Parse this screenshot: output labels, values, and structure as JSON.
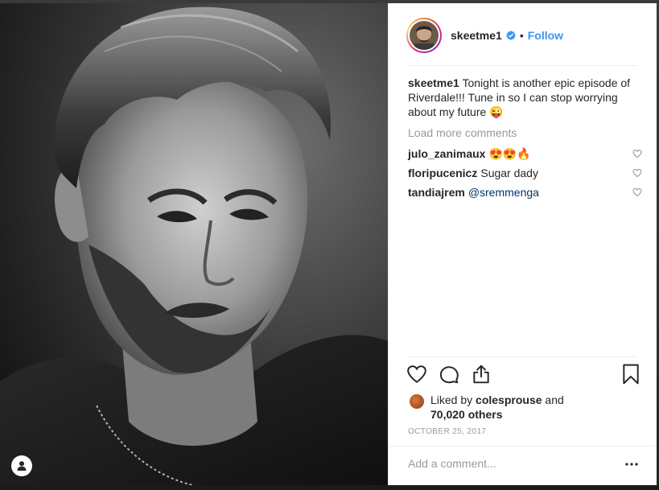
{
  "header": {
    "username": "skeetme1",
    "separator": "•",
    "follow_label": "Follow"
  },
  "caption": {
    "username": "skeetme1",
    "text": "Tonight is another epic episode of Riverdale!!! Tune in so I can stop worrying about my future 😜"
  },
  "load_more_label": "Load more comments",
  "comments": [
    {
      "username": "julo_zanimaux",
      "text": "😍😍🔥"
    },
    {
      "username": "floripucenicz",
      "text": "Sugar dady"
    },
    {
      "username": "tandiajrem",
      "text": "@sremmenga"
    }
  ],
  "likes": {
    "prefix": "Liked by",
    "liker": "colesprouse",
    "connector": "and",
    "others": "70,020 others"
  },
  "date": "OCTOBER 25, 2017",
  "add_comment_placeholder": "Add a comment...",
  "colors": {
    "follow": "#3897f0",
    "verified": "#3897f0",
    "mention": "#003569",
    "muted": "#999999",
    "text": "#262626"
  },
  "icons": [
    "heart-icon",
    "comment-icon",
    "share-icon",
    "bookmark-icon",
    "more-options-icon",
    "verified-badge-icon",
    "profile-icon"
  ]
}
